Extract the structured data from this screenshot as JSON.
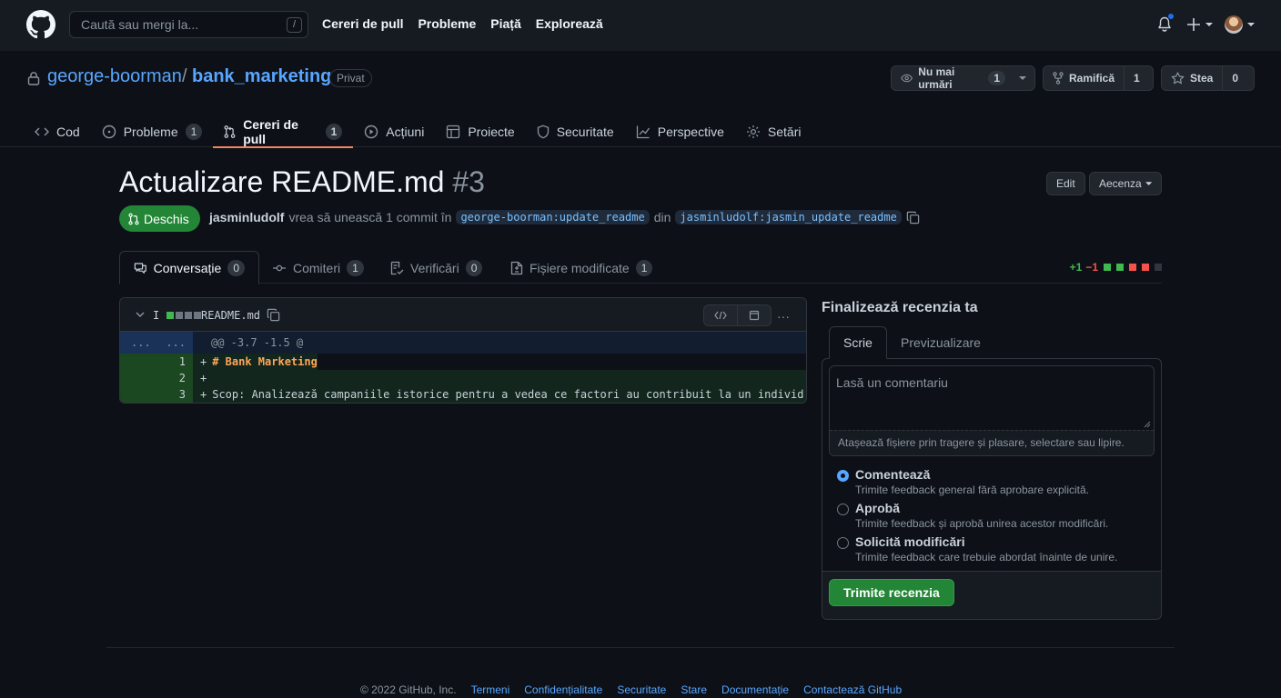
{
  "header": {
    "search_placeholder": "Caută sau mergi la...",
    "search_shortcut": "/",
    "nav": [
      "Cereri de pull",
      "Probleme",
      "Piață",
      "Explorează"
    ]
  },
  "repo": {
    "owner": "george-boorman",
    "separator": "/",
    "name": "bank_marketing",
    "visibility": "Privat",
    "watch": {
      "label": "Nu mai urmări",
      "count": "1"
    },
    "fork": {
      "label": "Ramifică",
      "count": "1"
    },
    "star": {
      "label": "Stea",
      "count": "0"
    },
    "tabs": [
      {
        "label": "Cod",
        "count": ""
      },
      {
        "label": "Probleme",
        "count": "1"
      },
      {
        "label": "Cereri de pull",
        "count": "1"
      },
      {
        "label": "Acțiuni",
        "count": ""
      },
      {
        "label": "Proiecte",
        "count": ""
      },
      {
        "label": "Securitate",
        "count": ""
      },
      {
        "label": "Perspective",
        "count": ""
      },
      {
        "label": "Setări",
        "count": ""
      }
    ]
  },
  "pr": {
    "title": "Actualizare README.md",
    "number": "#3",
    "edit_label": "Edit",
    "code_label": "Aecenza",
    "state": "Deschis",
    "author": "jasminludolf",
    "meta_text": "vrea să unească 1 commit în",
    "base_branch": "george-boorman:update_readme",
    "from_text": "din",
    "head_branch": "jasminludolf:jasmin_update_readme",
    "tabs": [
      {
        "label": "Conversație",
        "count": "0"
      },
      {
        "label": "Comiteri",
        "count": "1"
      },
      {
        "label": "Verificări",
        "count": "0"
      },
      {
        "label": "Fișiere modificate",
        "count": "1"
      }
    ],
    "diffstat_add": "+1",
    "diffstat_del": "−1"
  },
  "file": {
    "change_count": "I",
    "name": "README.md",
    "hunk_left": "...",
    "hunk_right": "...",
    "hunk_header": "@@ -3.7 -1.5 @",
    "lines": [
      {
        "num": "1",
        "marker": "+",
        "text": "# Bank Marketing",
        "heading": true
      },
      {
        "num": "2",
        "marker": "+",
        "text": "",
        "heading": false
      },
      {
        "num": "3",
        "marker": "+",
        "text": "Scop: Analizează campaniile istorice pentru a vedea ce factori au contribuit la un individ mar",
        "heading": false
      }
    ]
  },
  "review": {
    "title": "Finalizează recenzia ta",
    "tab_write": "Scrie",
    "tab_preview": "Previzualizare",
    "comment_placeholder": "Lasă un comentariu",
    "attach_text": "Atașează fișiere prin tragere și plasare, selectare sau lipire.",
    "options": [
      {
        "title": "Comentează",
        "desc": "Trimite feedback general fără aprobare explicită."
      },
      {
        "title": "Aprobă",
        "desc": "Trimite feedback și aprobă unirea acestor modificări."
      },
      {
        "title": "Solicită modificări",
        "desc": "Trimite feedback care trebuie abordat înainte de unire."
      }
    ],
    "submit_label": "Trimite recenzia"
  },
  "footer": {
    "copyright": "© 2022 GitHub, Inc.",
    "links": [
      "Termeni",
      "Confidențialitate",
      "Securitate",
      "Stare",
      "Documentație",
      "Contactează GitHub"
    ]
  }
}
